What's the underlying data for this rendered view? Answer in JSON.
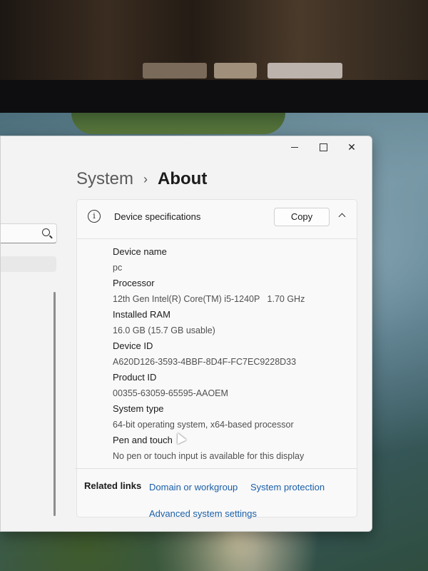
{
  "window": {
    "minimize_label": "Minimize",
    "maximize_label": "Maximize",
    "close_symbol": "✕"
  },
  "breadcrumb": {
    "parent": "System",
    "separator": "›",
    "current": "About"
  },
  "device_specs": {
    "header_icon": "info-icon",
    "header_icon_glyph": "i",
    "title": "Device specifications",
    "copy_label": "Copy",
    "items": [
      {
        "label": "Device name",
        "value": "pc"
      },
      {
        "label": "Processor",
        "value": "12th Gen Intel(R) Core(TM) i5-1240P   1.70 GHz"
      },
      {
        "label": "Installed RAM",
        "value": "16.0 GB (15.7 GB usable)"
      },
      {
        "label": "Device ID",
        "value": "A620D126-3593-4BBF-8D4F-FC7EC9228D33"
      },
      {
        "label": "Product ID",
        "value": "00355-63059-65595-AAOEM"
      },
      {
        "label": "System type",
        "value": "64-bit operating system, x64-based processor"
      },
      {
        "label": "Pen and touch",
        "value": "No pen or touch input is available for this display"
      }
    ]
  },
  "related_links": {
    "label": "Related links",
    "links": [
      "Domain or workgroup",
      "System protection",
      "Advanced system settings"
    ]
  },
  "colors": {
    "link": "#1a5fa8",
    "window_bg": "#f3f3f3"
  }
}
